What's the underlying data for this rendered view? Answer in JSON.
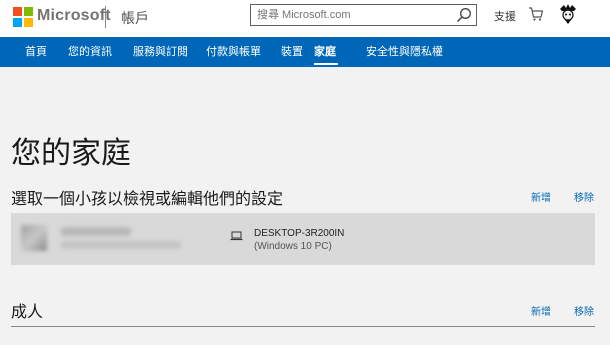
{
  "header": {
    "brand": "Microsoft",
    "section": "帳戶",
    "search": {
      "placeholder": "搜尋 Microsoft.com"
    },
    "support_label": "支援"
  },
  "nav": {
    "items": [
      "首頁",
      "您的資訊",
      "服務與訂閱",
      "付款與帳單",
      "裝置",
      "家庭",
      "安全性與隱私權"
    ],
    "active": "家庭"
  },
  "main": {
    "title": "您的家庭",
    "children_section": {
      "heading": "選取一個小孩以檢視或編輯他們的設定",
      "add_label": "新增",
      "remove_label": "移除",
      "child": {
        "device_name": "DESKTOP-3R200IN",
        "device_os": "(Windows 10 PC)"
      }
    },
    "adults_section": {
      "heading": "成人",
      "add_label": "新增",
      "remove_label": "移除"
    }
  },
  "colors": {
    "nav_bg": "#0067b8",
    "link": "#0067b8",
    "ms_red": "#f25022",
    "ms_green": "#7fba00",
    "ms_blue": "#00a4ef",
    "ms_yellow": "#ffb900"
  }
}
